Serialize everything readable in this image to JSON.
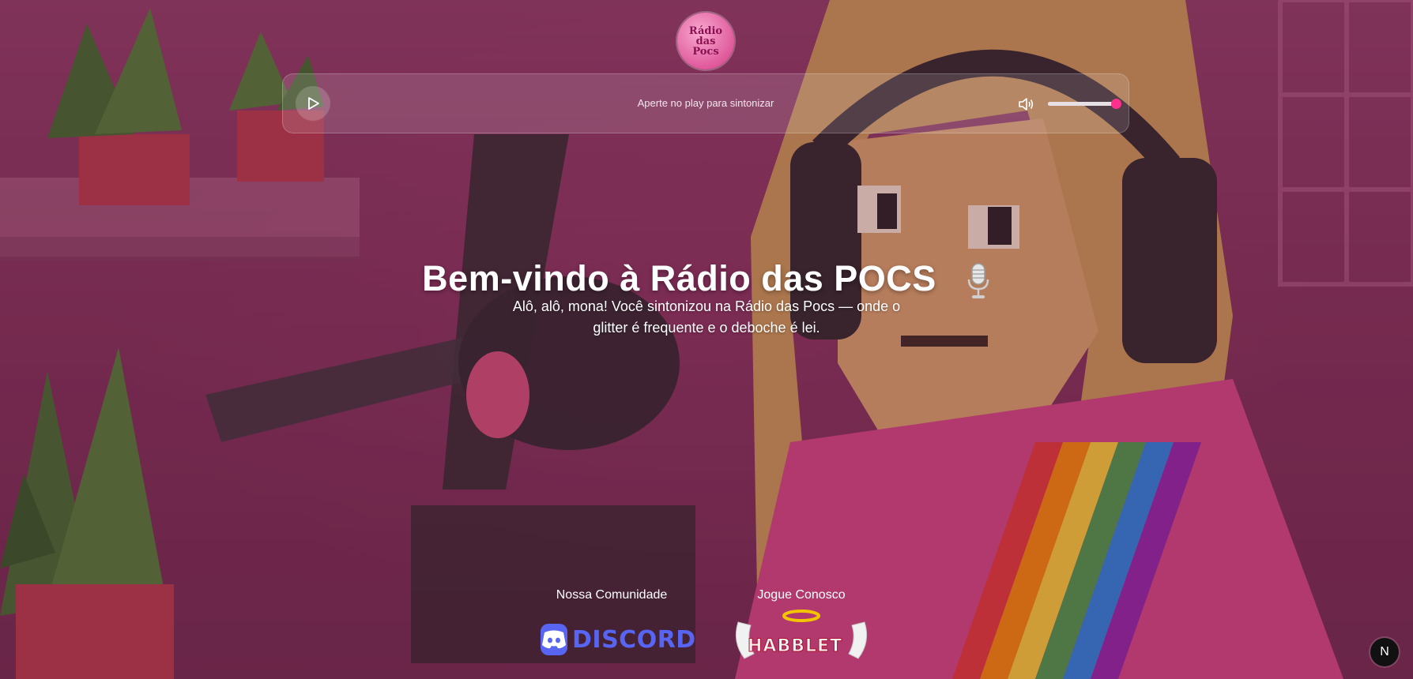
{
  "logo": {
    "line1": "Rádio",
    "line2": "das",
    "line3": "Pocs"
  },
  "player": {
    "status_text": "Aperte no play para sintonizar",
    "play_icon": "play-icon",
    "volume_icon": "volume-icon",
    "volume_level": 1.0
  },
  "hero": {
    "title": "Bem-vindo à Rádio das POCS",
    "title_icon": "microphone-icon",
    "subtitle": "Alô, alô, mona! Você sintonizou na Rádio das Pocs — onde o glitter é frequente e o deboche é lei."
  },
  "footer": {
    "community_label": "Nossa Comunidade",
    "community_link_text": "DISCORD",
    "game_label": "Jogue Conosco",
    "game_link_text": "HABBLET"
  },
  "corner_badge": {
    "letter": "N"
  },
  "colors": {
    "accent": "#ff2f8e",
    "discord": "#5865f2",
    "background": "#8a3a63"
  }
}
